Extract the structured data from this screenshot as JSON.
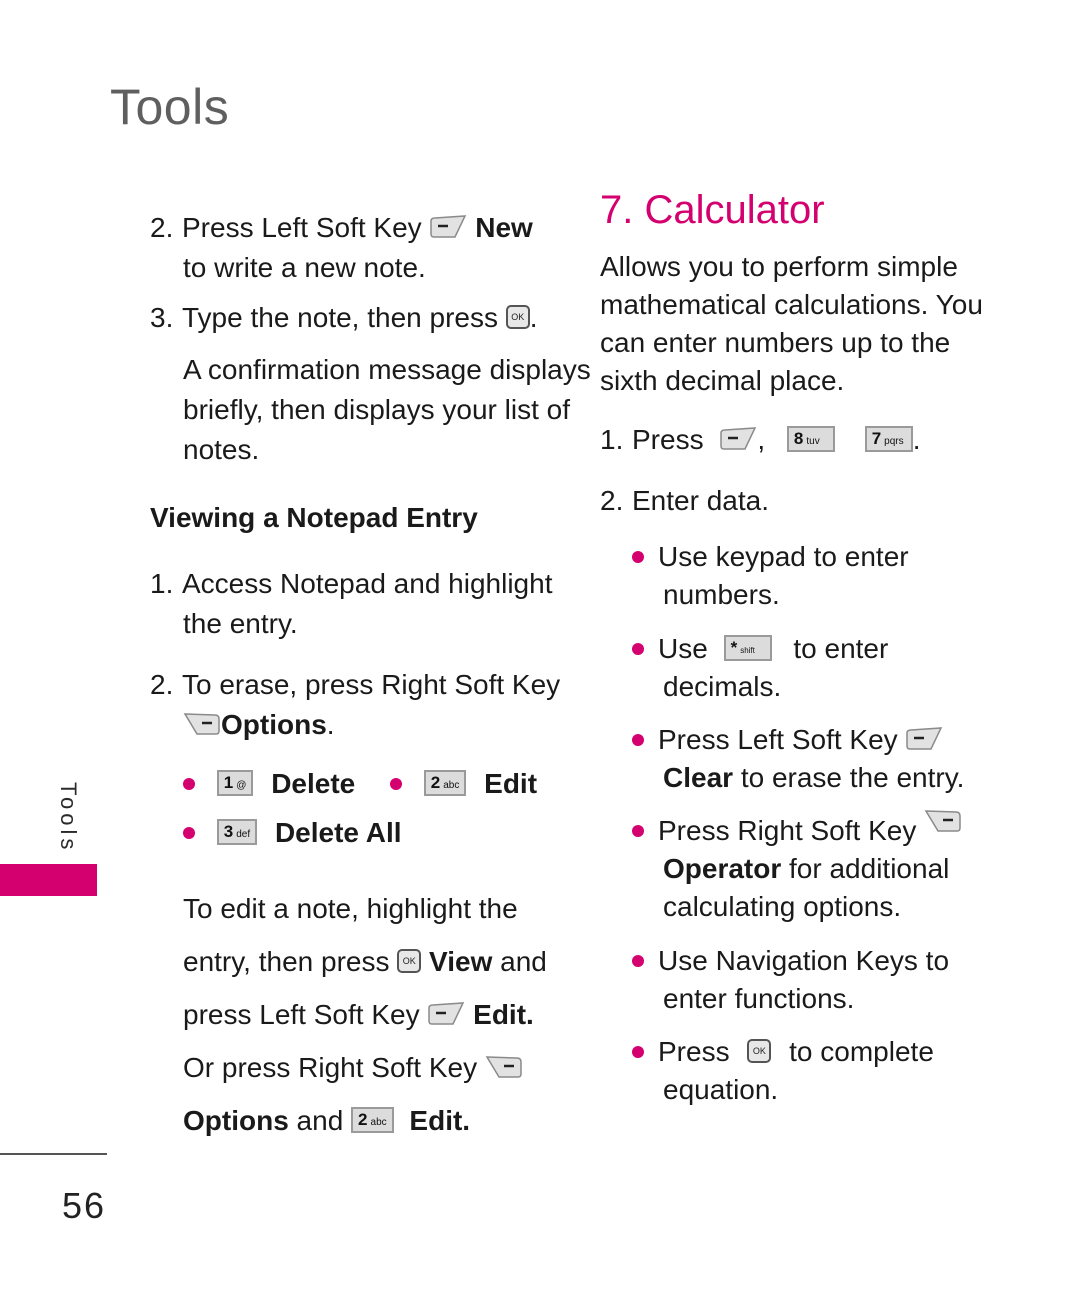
{
  "header": {
    "title": "Tools"
  },
  "side_tab": {
    "label": "Tools",
    "accent_color": "#d4006f"
  },
  "footer": {
    "page_number": "56"
  },
  "left_column": {
    "step2": {
      "num": "2.",
      "text": "Press Left Soft Key",
      "bold": "New",
      "cont": "to write a new note."
    },
    "step3": {
      "num": "3.",
      "text": "Type the note, then press",
      "end": "."
    },
    "confirm": [
      "A confirmation message displays",
      "briefly, then displays your list of",
      "notes."
    ],
    "section_heading": "Viewing a Notepad Entry",
    "v1": {
      "num": "1.",
      "line1": "Access Notepad and highlight",
      "line2": "the entry."
    },
    "v2": {
      "num": "2.",
      "line1": "To erase, press Right Soft Key",
      "bold": "Options",
      "end": "."
    },
    "options": [
      {
        "key_num": "1",
        "key_sub": "@",
        "label": "Delete"
      },
      {
        "key_num": "2",
        "key_sub": "abc",
        "label": "Edit"
      },
      {
        "key_num": "3",
        "key_sub": "def",
        "label": "Delete All"
      }
    ],
    "edit_para": {
      "l1": "To edit a note, highlight the",
      "l2a": "entry, then press",
      "l2b": "View",
      "l2c": "and",
      "l3a": "press Left Soft Key",
      "l3b": "Edit.",
      "l4": "Or press Right Soft Key",
      "l5a": "Options",
      "l5b": "and",
      "l5key_num": "2",
      "l5key_sub": "abc",
      "l5c": "Edit."
    }
  },
  "right_column": {
    "heading": "7. Calculator",
    "intro": [
      "Allows you to perform simple",
      "mathematical calculations. You",
      "can enter numbers up to the",
      "sixth decimal place."
    ],
    "s1": {
      "num": "1.",
      "text": "Press",
      "comma": ",",
      "k1_num": "8",
      "k1_sub": "tuv",
      "k2_num": "7",
      "k2_sub": "pqrs",
      "end": "."
    },
    "s2": {
      "num": "2.",
      "text": "Enter data."
    },
    "bullets": {
      "b1": [
        "Use keypad to enter",
        "numbers."
      ],
      "b2": {
        "a": "Use",
        "key_num": "*",
        "key_sub": "shift",
        "b": "to enter",
        "c": "decimals."
      },
      "b3": {
        "a": "Press Left Soft Key",
        "bold": "Clear",
        "b": "to erase the entry."
      },
      "b4": {
        "a": "Press Right Soft Key",
        "bold": "Operator",
        "b": "for additional",
        "c": "calculating options."
      },
      "b5": [
        "Use Navigation Keys to",
        "enter functions."
      ],
      "b6": {
        "a": "Press",
        "b": "to complete",
        "c": "equation."
      }
    }
  }
}
